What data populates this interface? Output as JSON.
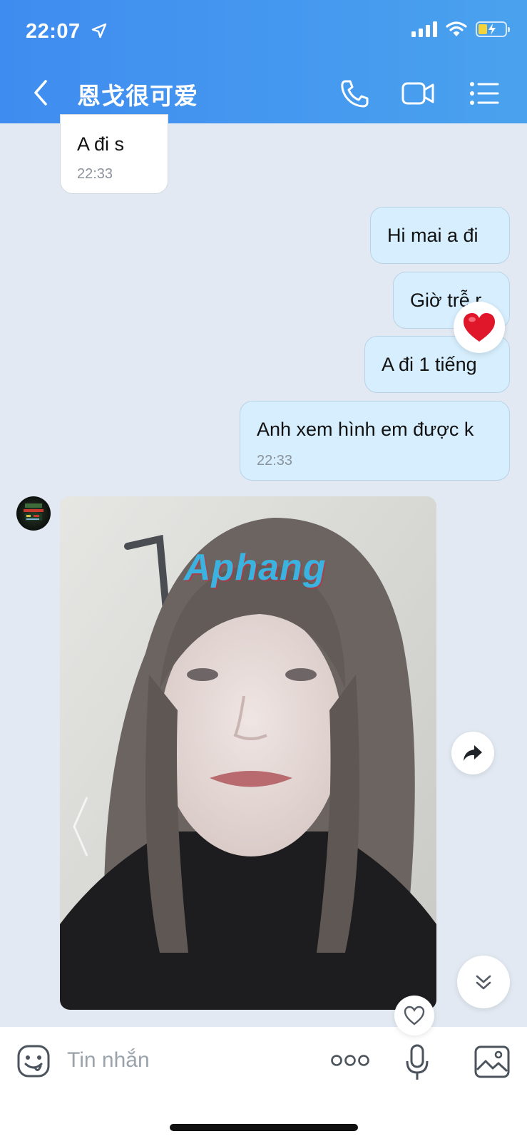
{
  "status": {
    "time": "22:07"
  },
  "header": {
    "title": "恩戈很可爱"
  },
  "messages": [
    {
      "text": "A đi s",
      "time": "22:33",
      "dir": "in"
    },
    {
      "text": "Hi mai a đi",
      "dir": "out"
    },
    {
      "text": "Giờ trễ r",
      "dir": "out",
      "reaction": "heart"
    },
    {
      "text": "A đi 1 tiếng",
      "dir": "out"
    },
    {
      "text": "Anh xem hình em được k",
      "time": "22:33",
      "dir": "out"
    }
  ],
  "photo": {
    "watermark": "Aphang"
  },
  "input": {
    "placeholder": "Tin nhắn"
  },
  "colors": {
    "header_start": "#3f8cf0",
    "header_end": "#4aa2ee",
    "outgoing_bubble": "#d6eefd",
    "background": "#e2e9f2",
    "heart": "#e0162b"
  },
  "icons": [
    "location-arrow-icon",
    "signal-icon",
    "wifi-icon",
    "battery-charging-icon",
    "back-chevron-icon",
    "phone-icon",
    "video-camera-icon",
    "menu-list-icon",
    "heart-reaction-icon",
    "forward-icon",
    "scroll-down-icon",
    "like-heart-icon",
    "sticker-icon",
    "more-icon",
    "microphone-icon",
    "image-icon"
  ]
}
